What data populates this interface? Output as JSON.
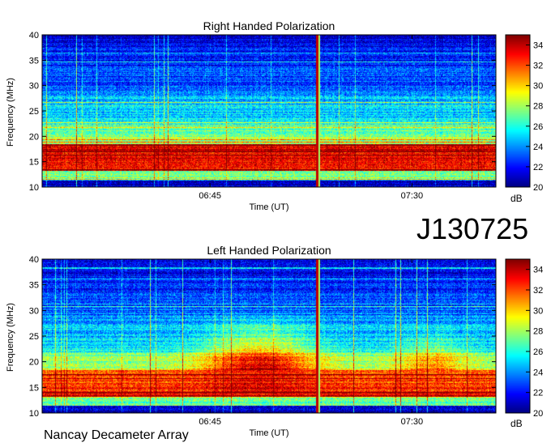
{
  "observation_id": "J130725",
  "footer": "Nancay Decameter Array",
  "colorbar_unit": "dB",
  "chart_data": [
    {
      "type": "heatmap",
      "title": "Right Handed Polarization",
      "xlabel": "Time (UT)",
      "ylabel": "Frequency (MHz)",
      "x_ticks": [
        "06:45",
        "07:30"
      ],
      "y_ticks": [
        10,
        15,
        20,
        25,
        30,
        35,
        40
      ],
      "ylim": [
        10,
        40
      ],
      "colorbar": {
        "ticks": [
          20,
          22,
          24,
          26,
          28,
          30,
          32,
          34
        ],
        "range": [
          20,
          35
        ],
        "unit": "dB"
      }
    },
    {
      "type": "heatmap",
      "title": "Left Handed Polarization",
      "xlabel": "Time (UT)",
      "ylabel": "Frequency (MHz)",
      "x_ticks": [
        "06:45",
        "07:30"
      ],
      "y_ticks": [
        10,
        15,
        20,
        25,
        30,
        35,
        40
      ],
      "ylim": [
        10,
        40
      ],
      "colorbar": {
        "ticks": [
          20,
          22,
          24,
          26,
          28,
          30,
          32,
          34
        ],
        "range": [
          20,
          35
        ],
        "unit": "dB"
      }
    }
  ]
}
